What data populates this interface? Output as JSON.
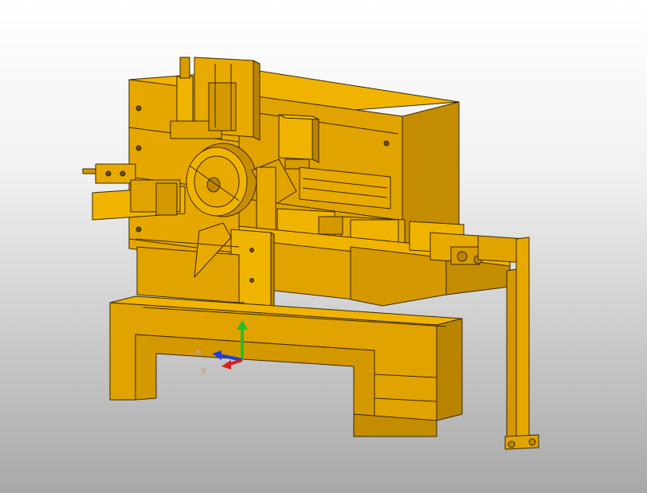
{
  "viewport": {
    "model": "spring-forming-machine-assembly",
    "material_colors": {
      "body": "#e0a300",
      "body_light": "#f0b400",
      "body_dark": "#b98400",
      "edge": "#3a2800"
    }
  },
  "triad": {
    "x_label": "X",
    "x_color": "#d42020",
    "y_color": "#22c02a",
    "z_color": "#2040d0"
  }
}
